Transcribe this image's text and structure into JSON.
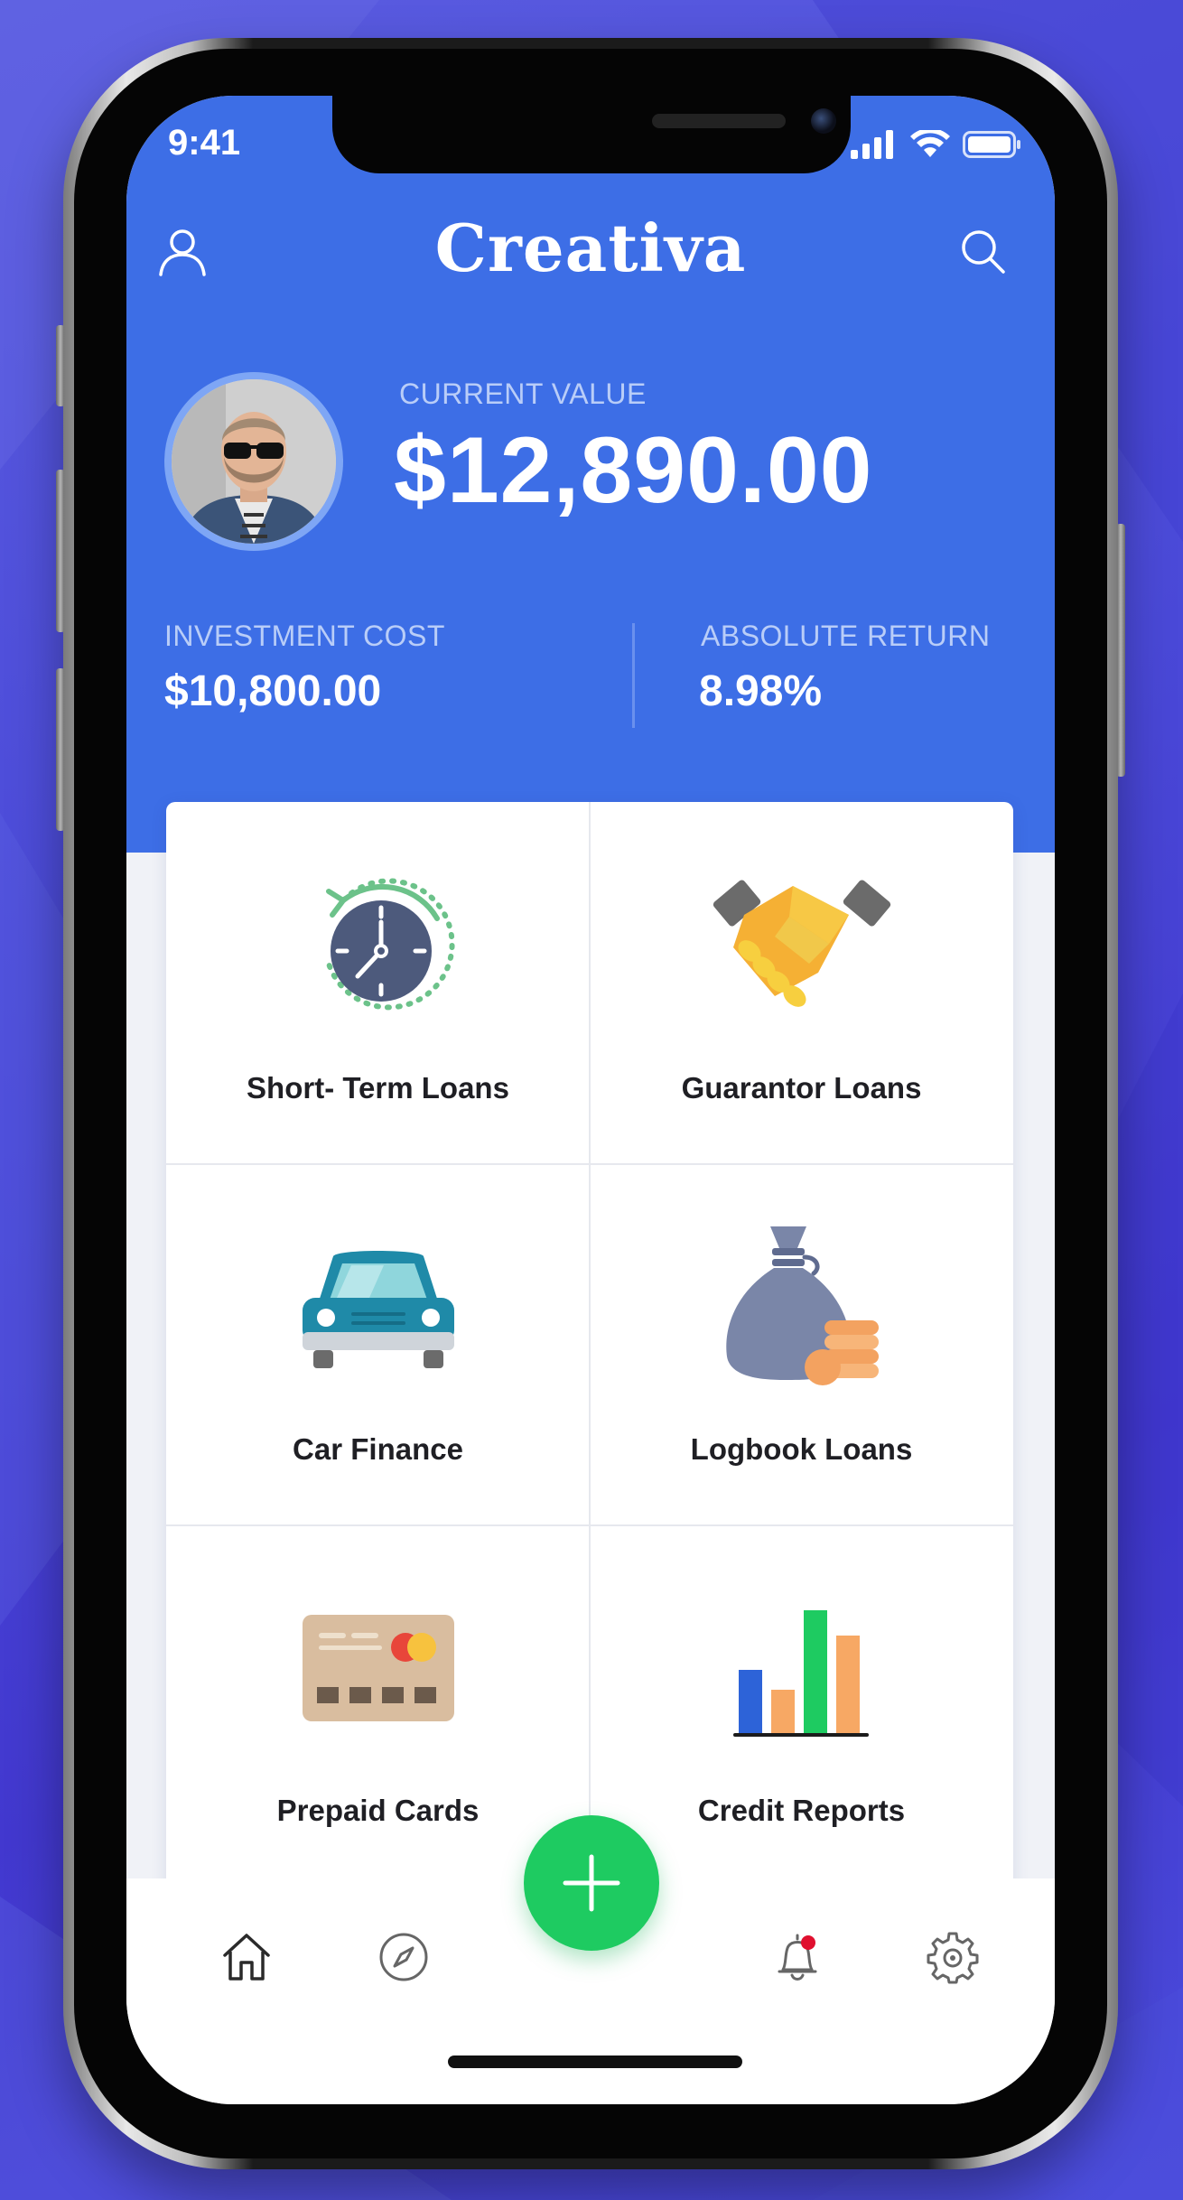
{
  "status_bar": {
    "time": "9:41"
  },
  "header": {
    "title": "Creativa",
    "profile_icon": "user-icon",
    "search_icon": "search-icon"
  },
  "summary": {
    "current_value_label": "CURRENT VALUE",
    "current_value": "$12,890.00",
    "investment_cost_label": "INVESTMENT COST",
    "investment_cost": "$10,800.00",
    "absolute_return_label": "ABSOLUTE RETURN",
    "absolute_return": "8.98%"
  },
  "services": [
    {
      "label": "Short- Term Loans",
      "icon": "clock-refresh-icon"
    },
    {
      "label": "Guarantor Loans",
      "icon": "handshake-icon"
    },
    {
      "label": "Car Finance",
      "icon": "car-icon"
    },
    {
      "label": "Logbook Loans",
      "icon": "money-bag-icon"
    },
    {
      "label": "Prepaid Cards",
      "icon": "credit-card-icon"
    },
    {
      "label": "Credit Reports",
      "icon": "bar-chart-icon"
    }
  ],
  "tabbar": {
    "items": [
      "home-icon",
      "compass-icon",
      "plus-icon",
      "bell-icon",
      "gear-icon"
    ]
  },
  "colors": {
    "primary": "#3d6ee6",
    "fab": "#1ecb61",
    "background": "#4a49d8"
  }
}
